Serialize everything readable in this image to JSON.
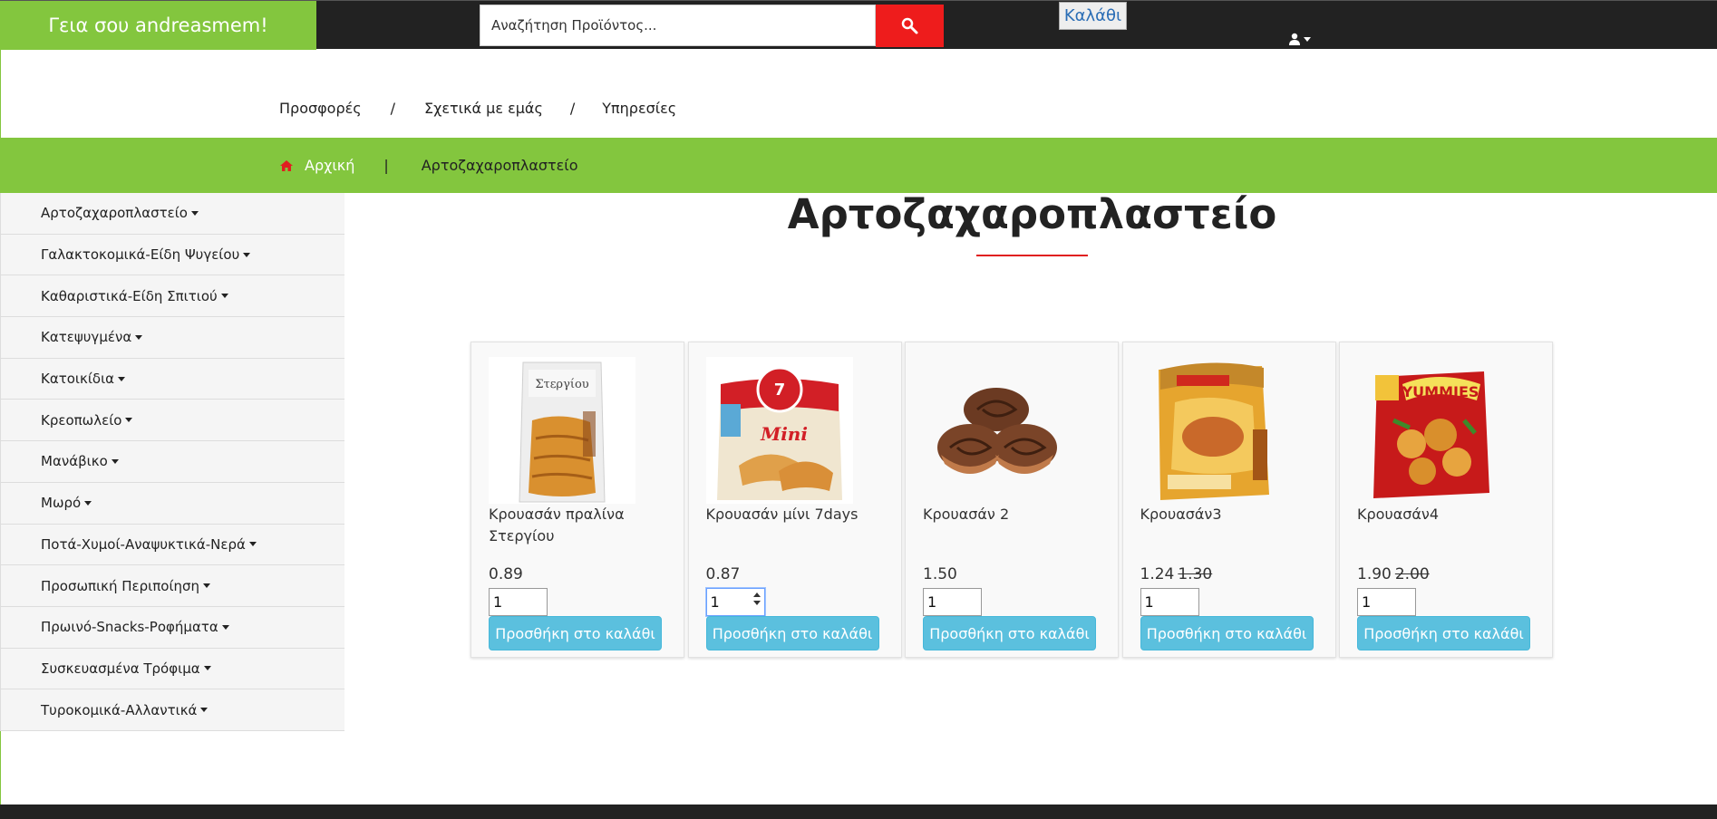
{
  "topbar": {
    "greeting": "Γεια σου andreasmem!",
    "search_placeholder": "Αναζήτηση Προϊόντος...",
    "cart_label": "Καλάθι"
  },
  "nav": {
    "links": [
      "Προσφορές",
      "Σχετικά με εμάς",
      "Υπηρεσίες"
    ],
    "separator": "/"
  },
  "breadcrumb": {
    "home": "Αρχική",
    "separator": "|",
    "current": "Αρτοζαχαροπλαστείο"
  },
  "sidebar": {
    "items": [
      {
        "label": "Αρτοζαχαροπλαστείο"
      },
      {
        "label": "Γαλακτοκομικά-Είδη Ψυγείου"
      },
      {
        "label": "Καθαριστικά-Είδη Σπιτιού"
      },
      {
        "label": "Κατεψυγμένα"
      },
      {
        "label": "Κατοικίδια"
      },
      {
        "label": "Κρεοπωλείο"
      },
      {
        "label": "Μανάβικο"
      },
      {
        "label": "Μωρό"
      },
      {
        "label": "Ποτά-Χυμοί-Αναψυκτικά-Νερά"
      },
      {
        "label": "Προσωπική Περιποίηση"
      },
      {
        "label": "Πρωινό-Snacks-Ροφήματα"
      },
      {
        "label": "Συσκευασμένα Τρόφιμα"
      },
      {
        "label": "Τυροκομικά-Αλλαντικά"
      }
    ]
  },
  "page": {
    "title": "Αρτοζαχαροπλαστείο"
  },
  "products": [
    {
      "name": "Κρουασάν πραλίνα Στεργίου",
      "price": "0.89",
      "old_price": "",
      "qty": "1",
      "add_label": "Προσθήκη στο καλάθι",
      "image": "croissant-praline-bag"
    },
    {
      "name": "Κρουασάν μίνι 7days",
      "price": "0.87",
      "old_price": "",
      "qty": "1",
      "add_label": "Προσθήκη στο καλάθι",
      "image": "7days-mini-croissant-bag"
    },
    {
      "name": "Κρουασάν 2",
      "price": "1.50",
      "old_price": "",
      "qty": "1",
      "add_label": "Προσθήκη στο καλάθι",
      "image": "cinnamon-rolls"
    },
    {
      "name": "Κρουασάν3",
      "price": "1.24",
      "old_price": "1.30",
      "qty": "1",
      "add_label": "Προσθήκη στο καλάθι",
      "image": "rusk-pack"
    },
    {
      "name": "Κρουασάν4",
      "price": "1.90",
      "old_price": "2.00",
      "qty": "1",
      "add_label": "Προσθήκη στο καλάθι",
      "image": "yummies-snack-pack"
    }
  ],
  "colors": {
    "accent_green": "#83c63e",
    "dark_bar": "#222222",
    "search_red": "#ee1c1c",
    "button_blue": "#5bc0de"
  }
}
